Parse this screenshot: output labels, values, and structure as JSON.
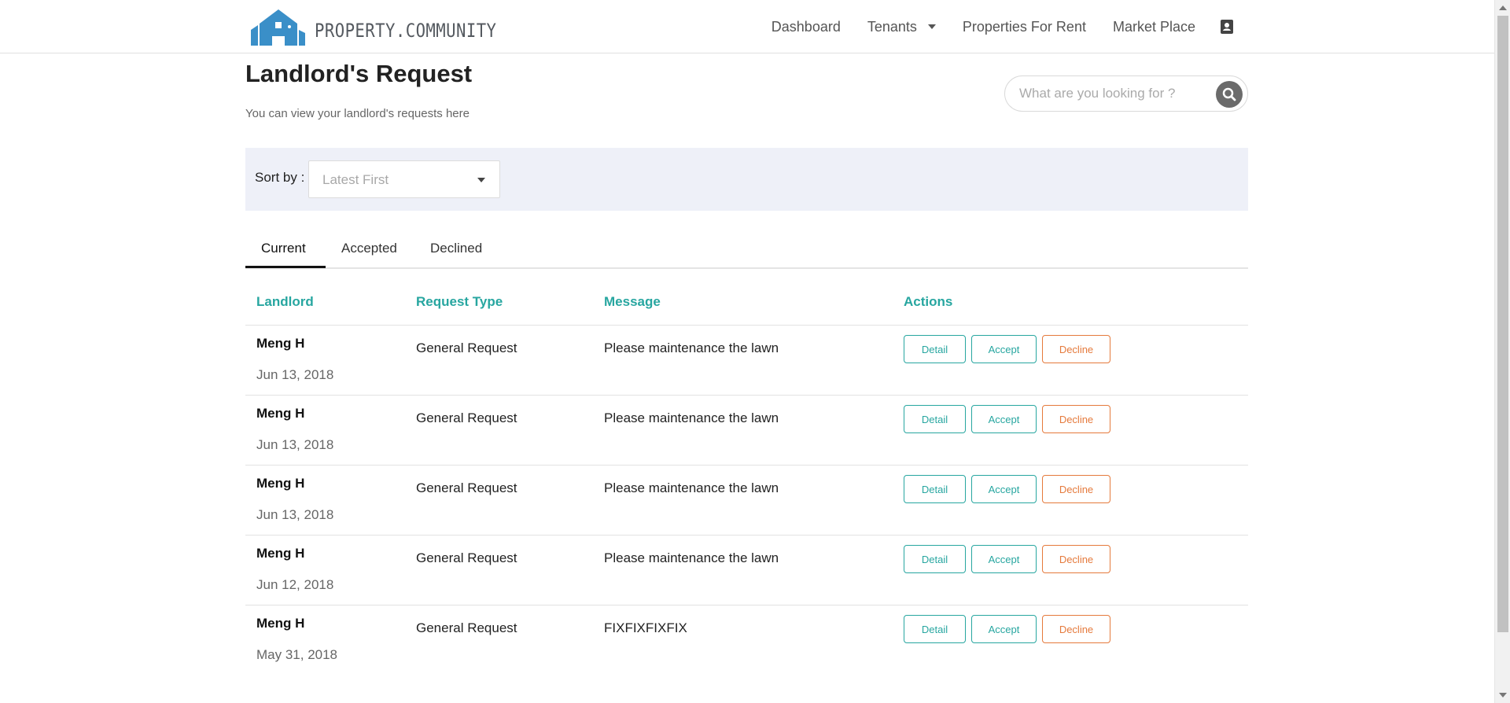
{
  "brand": {
    "name": "PROPERTY.COMMUNITY"
  },
  "nav": {
    "dashboard": "Dashboard",
    "tenants": "Tenants",
    "properties_for_rent": "Properties For Rent",
    "market_place": "Market Place"
  },
  "header": {
    "title": "Landlord's Request",
    "subtitle": "You can view your landlord's requests here"
  },
  "search": {
    "placeholder": "What are you looking for ?"
  },
  "sort": {
    "label": "Sort by :",
    "selected": "Latest First"
  },
  "tabs": [
    {
      "label": "Current"
    },
    {
      "label": "Accepted"
    },
    {
      "label": "Declined"
    }
  ],
  "table": {
    "headers": {
      "landlord": "Landlord",
      "request_type": "Request Type",
      "message": "Message",
      "actions": "Actions"
    },
    "rows": [
      {
        "landlord": "Meng H",
        "date": "Jun 13, 2018",
        "type": "General Request",
        "message": "Please maintenance the lawn"
      },
      {
        "landlord": "Meng H",
        "date": "Jun 13, 2018",
        "type": "General Request",
        "message": "Please maintenance the lawn"
      },
      {
        "landlord": "Meng H",
        "date": "Jun 13, 2018",
        "type": "General Request",
        "message": "Please maintenance the lawn"
      },
      {
        "landlord": "Meng H",
        "date": "Jun 12, 2018",
        "type": "General Request",
        "message": "Please maintenance the lawn"
      },
      {
        "landlord": "Meng H",
        "date": "May 31, 2018",
        "type": "General Request",
        "message": "FIXFIXFIXFIX"
      }
    ]
  },
  "actions": {
    "detail": "Detail",
    "accept": "Accept",
    "decline": "Decline"
  },
  "icons": {
    "logo": "house-logo-icon",
    "tenants_dropdown": "caret-down-icon",
    "user": "contact-card-icon",
    "search": "search-icon",
    "sort_dropdown": "caret-down-icon"
  },
  "colors": {
    "accent": "#27a6a0",
    "decline": "#e57a3c",
    "logo": "#3a8fc8",
    "sortbar_bg": "#eef0f8"
  }
}
